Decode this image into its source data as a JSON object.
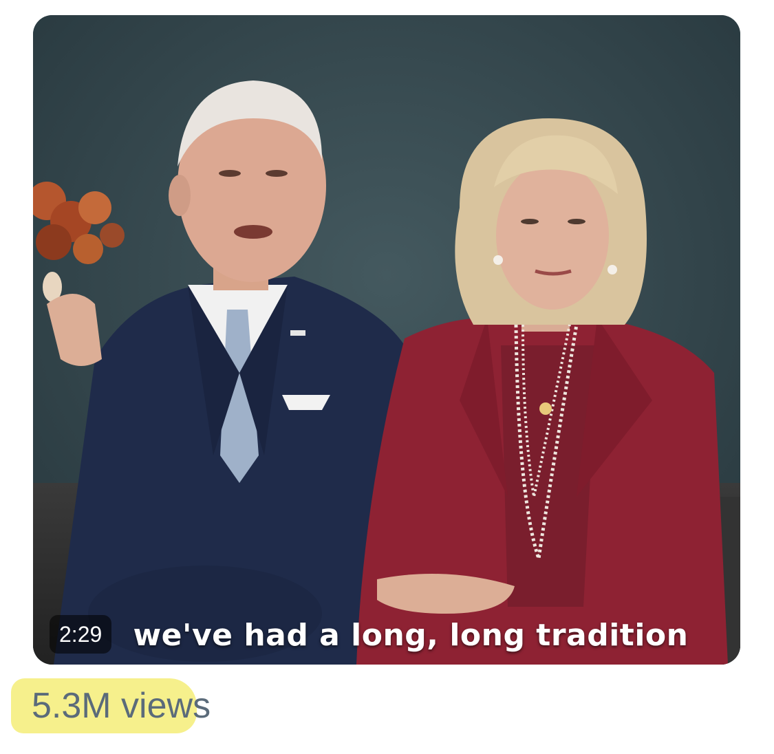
{
  "video": {
    "duration": "2:29",
    "caption": "we've had a long, long tradition"
  },
  "stats": {
    "views": "5.3M views"
  },
  "colors": {
    "background": "#ffffff",
    "views_text": "#5b6b7a",
    "highlight": "#f6f08c",
    "backdrop": "#34484f",
    "suit_navy": "#1f2b4a",
    "blazer_red": "#8e2233"
  }
}
